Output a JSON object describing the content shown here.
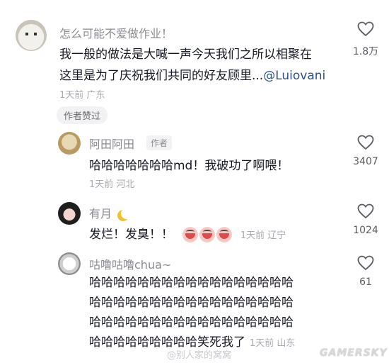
{
  "comments": [
    {
      "username": "怎么可能不爱做作业！",
      "text_lines": [
        "我一般的做法是大喊一声今天我们之所以相聚在",
        "这里是为了庆祝我们共同的好友顾里..."
      ],
      "mention": "@Luiovani",
      "time_location": "1天前 广东",
      "likes": "1.8万",
      "author_liked": "作者赞过"
    },
    {
      "username": "阿田阿田",
      "author_tag": "作者",
      "text": "哈哈哈哈哈哈哈md！我破功了啊喂！",
      "time_location": "1天前 河北",
      "likes": "3407"
    },
    {
      "username": "有月",
      "text": "发烂！发臭！！",
      "time_location": "1天前 辽宁",
      "likes": "1024"
    },
    {
      "username": "咕噜咕噜chua~",
      "text_lines": [
        "哈哈哈哈哈哈哈哈哈哈哈哈哈哈哈哈哈",
        "哈哈哈哈哈哈哈哈哈哈哈哈哈哈哈哈哈",
        "哈哈哈哈哈哈哈哈哈哈哈哈哈哈哈哈哈",
        "哈哈哈哈哈哈哈哈哈笑死我了"
      ],
      "time_location": "1天前 山东",
      "likes": "61"
    }
  ],
  "watermark": "@别人家的窝窝",
  "site_logo": "GAMERSKY",
  "icons": {
    "like": "heart-outline-icon",
    "moon": "crescent-moon-icon"
  }
}
